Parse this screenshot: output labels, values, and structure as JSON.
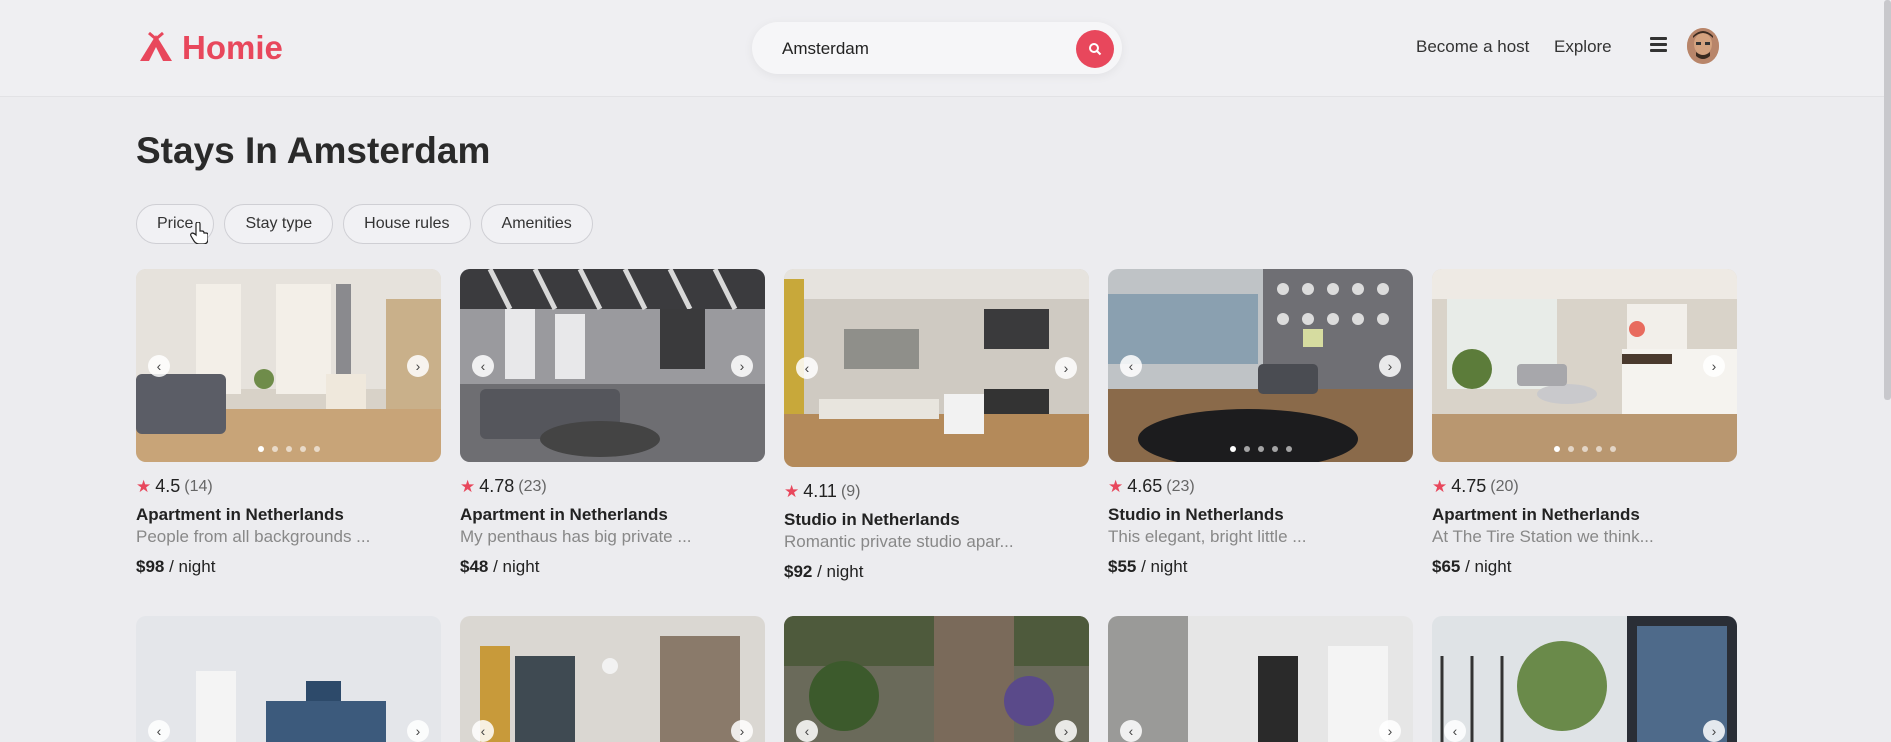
{
  "brand": {
    "name": "Homie",
    "color": "#e8475c"
  },
  "header": {
    "search_value": "Amsterdam",
    "nav": [
      "Become a host",
      "Explore"
    ],
    "icons": [
      "search-icon",
      "menu-icon",
      "avatar"
    ]
  },
  "main": {
    "title": "Stays In Amsterdam",
    "filters": [
      "Price",
      "Stay type",
      "House rules",
      "Amenities"
    ]
  },
  "listings": [
    {
      "rating": "4.5",
      "reviews": "(14)",
      "type": "Apartment in Netherlands",
      "desc": "People from all backgrounds ...",
      "price": "$98",
      "unit": "/ night"
    },
    {
      "rating": "4.78",
      "reviews": "(23)",
      "type": "Apartment in Netherlands",
      "desc": "My penthaus has big private ...",
      "price": "$48",
      "unit": "/ night"
    },
    {
      "rating": "4.11",
      "reviews": "(9)",
      "type": "Studio in Netherlands",
      "desc": "Romantic private studio apar...",
      "price": "$92",
      "unit": "/ night"
    },
    {
      "rating": "4.65",
      "reviews": "(23)",
      "type": "Studio in Netherlands",
      "desc": "This elegant, bright little ...",
      "price": "$55",
      "unit": "/ night"
    },
    {
      "rating": "4.75",
      "reviews": "(20)",
      "type": "Apartment in Netherlands",
      "desc": "At The Tire Station we think...",
      "price": "$65",
      "unit": "/ night"
    }
  ]
}
